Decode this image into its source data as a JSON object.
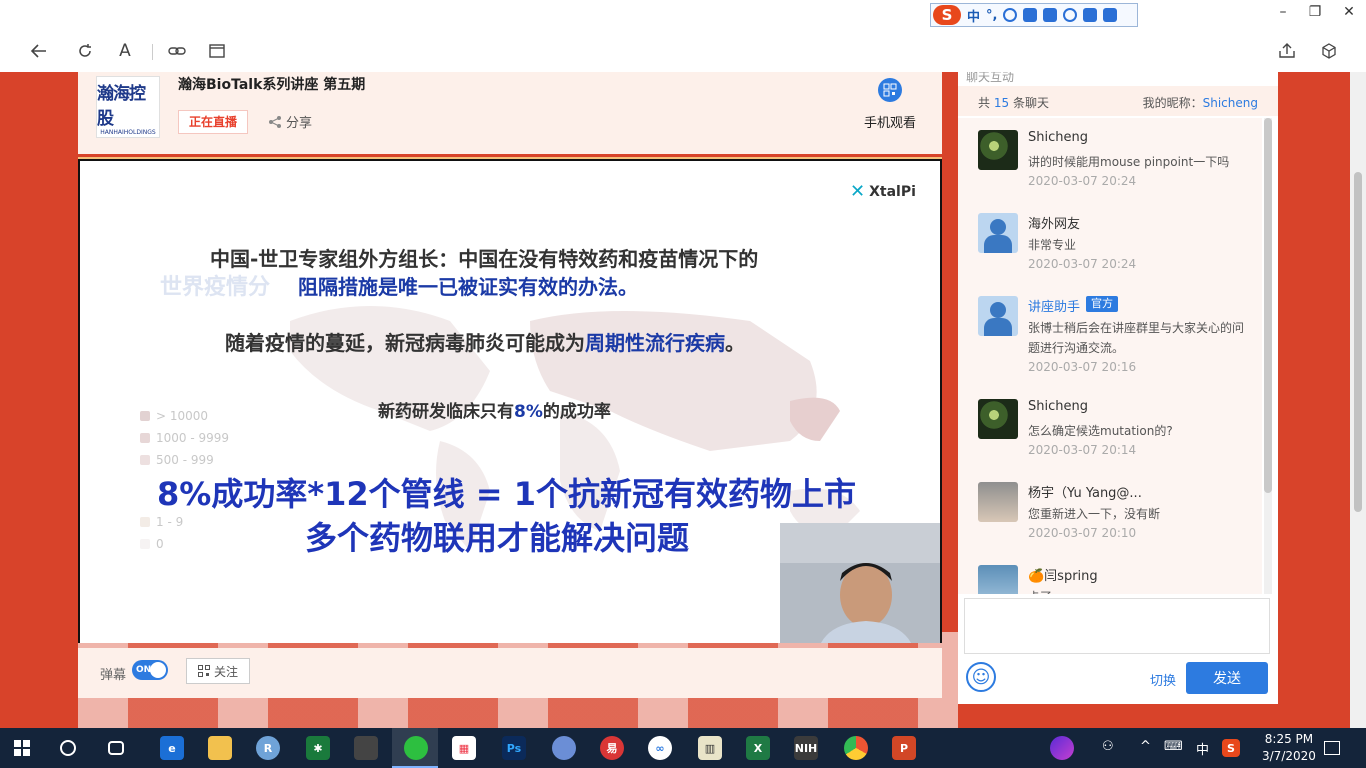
{
  "ime": {
    "logo": "S",
    "mode": "中",
    "punct": "°,"
  },
  "window": {
    "minimize": "–",
    "restore": "❐",
    "close": "✕"
  },
  "nav": {
    "reader_label": "A"
  },
  "header": {
    "logo_text": "瀚海控股",
    "logo_sub": "HANHAIHOLDINGS",
    "title": "瀚海BioTalk系列讲座 第五期",
    "live_badge": "正在直播",
    "share_label": "分享",
    "mobile_label": "手机观看"
  },
  "slide": {
    "brand": "XtalPi",
    "line1": "中国-世卫专家组外方组长：中国在没有特效药和疫苗情况下的",
    "ghost": "世界疫情分",
    "line2_hl": "阻隔措施是唯一已被证实有效的办法。",
    "line3_pre": "随着疫情的蔓延，新冠病毒肺炎可能成为",
    "line3_hl": "周期性流行疾病",
    "line3_post": "。",
    "line4_pre": "新药研发临床只有",
    "line4_hl": "8%",
    "line4_post": "的成功率",
    "big1": "8%成功率*12个管线 = 1个抗新冠有效药物上市",
    "big2": "多个药物联用才能解决问题",
    "legend": [
      "> 10000",
      "1000 - 9999",
      "500 - 999",
      "",
      "",
      "1 - 9",
      "0"
    ]
  },
  "controls": {
    "danmu_label": "弹幕",
    "toggle_text": "ON",
    "follow_label": "关注"
  },
  "chat": {
    "top_cut": "聊天互动",
    "count_prefix": "共",
    "count": "15",
    "count_suffix": "条聊天",
    "nickname_label": "我的昵称：",
    "nickname": "Shicheng",
    "messages": [
      {
        "name": "Shicheng",
        "text": "讲的时候能用mouse pinpoint一下吗",
        "time": "2020-03-07 20:24"
      },
      {
        "name": "海外网友",
        "text": "非常专业",
        "time": "2020-03-07 20:24"
      },
      {
        "name": "讲座助手",
        "badge": "官方",
        "text": "张博士稍后会在讲座群里与大家关心的问题进行沟通交流。",
        "time": "2020-03-07 20:16"
      },
      {
        "name": "Shicheng",
        "text": "怎么确定候选mutation的?",
        "time": "2020-03-07 20:14"
      },
      {
        "name": "杨宇（Yu Yang@...",
        "text": "您重新进入一下，没有断",
        "time": "2020-03-07 20:10"
      },
      {
        "name": "🍊闫spring",
        "text": "卡了",
        "time": ""
      }
    ],
    "switch_label": "切换",
    "send_label": "发送"
  },
  "taskbar": {
    "time": "8:25 PM",
    "date": "3/7/2020",
    "ime_lang": "中"
  }
}
